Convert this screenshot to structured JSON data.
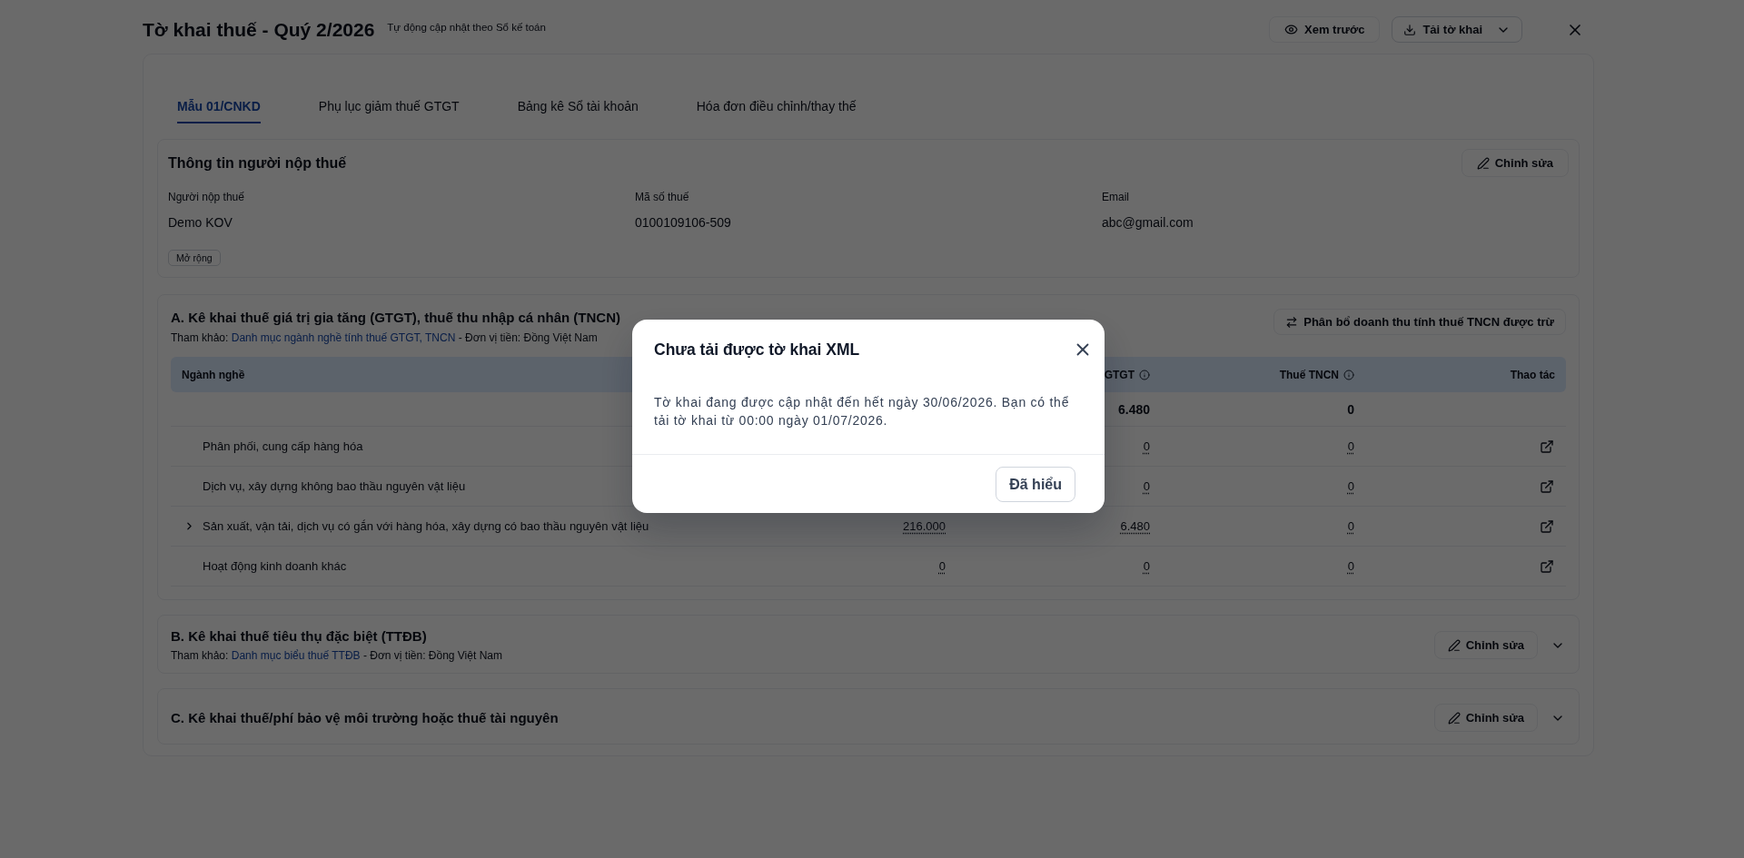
{
  "header": {
    "title": "Tờ khai thuế - Quý 2/2026",
    "subtitle": "Tự động cập nhật theo Sổ kế toán",
    "actions": [
      {
        "kind": "preview",
        "label": "Xem trước"
      },
      {
        "kind": "download",
        "label": "Tải tờ khai"
      }
    ]
  },
  "tabs": [
    {
      "label": "Mẫu 01/CNKD",
      "selected": true
    },
    {
      "label": "Phụ lục giảm thuế GTGT",
      "selected": false
    },
    {
      "label": "Bảng kê Sổ tài khoản",
      "selected": false
    },
    {
      "label": "Hóa đơn điều chỉnh/thay thế",
      "selected": false
    }
  ],
  "taxpayer": {
    "title": "Thông tin người nộp thuế",
    "edit_label": "Chỉnh sửa",
    "fields": [
      {
        "label": "Người nộp thuế",
        "value": "Demo KOV"
      },
      {
        "label": "Mã số thuế",
        "value": "0100109106-509"
      },
      {
        "label": "Email",
        "value": "abc@gmail.com"
      }
    ],
    "expand_label": "Mở rộng"
  },
  "sections": [
    {
      "kind": "table",
      "title": "A. Kê khai thuế giá trị gia tăng (GTGT), thuế thu nhập cá nhân (TNCN)",
      "reference": {
        "prefix": "Tham khảo:",
        "link": "Danh mục ngành nghề tính thuế GTGT, TNCN",
        "suffix": "- Đơn vị tiền: Đồng Việt Nam"
      },
      "action_label": "Phân bổ doanh thu tính thuế TNCN được trừ",
      "table": {
        "columns": [
          {
            "kind": "name",
            "label": "Ngành nghề"
          },
          {
            "kind": "revenue"
          },
          {
            "kind": "vat",
            "label": "GTGT",
            "info": true
          },
          {
            "kind": "pit",
            "label": "Thuế TNCN",
            "info": true
          },
          {
            "kind": "action",
            "label": "Thao tác"
          }
        ],
        "rows": [
          {
            "kind": "total",
            "vat": "6.480",
            "pit": "0"
          },
          {
            "kind": "item",
            "name": "Phân phối, cung cấp hàng hóa",
            "vat": "0",
            "pit": "0",
            "expandable": false
          },
          {
            "kind": "item",
            "name": "Dịch vụ, xây dựng không bao thầu nguyên vật liệu",
            "vat": "0",
            "pit": "0",
            "expandable": false
          },
          {
            "kind": "item",
            "name": "Sản xuất, vận tải, dịch vụ có gắn với hàng hóa, xây dựng có bao thầu nguyên vật liệu",
            "revenue": "216.000",
            "vat": "6.480",
            "pit": "0",
            "expandable": true,
            "expanded": false
          },
          {
            "kind": "item",
            "name": "Hoạt động kinh doanh khác",
            "revenue": "0",
            "vat": "0",
            "pit": "0",
            "expandable": false
          }
        ]
      }
    },
    {
      "kind": "collapsible",
      "title": "B. Kê khai thuế tiêu thụ đặc biệt (TTĐB)",
      "reference": {
        "prefix": "Tham khảo:",
        "link": "Danh mục biểu thuế TTĐB",
        "suffix": "- Đơn vị tiền: Đồng Việt Nam"
      },
      "edit_label": "Chỉnh sửa",
      "expanded": false
    },
    {
      "kind": "collapsible",
      "title": "C. Kê khai thuế/phí bảo vệ môi trường hoặc thuế tài nguyên",
      "edit_label": "Chỉnh sửa",
      "expanded": false
    }
  ],
  "dialog": {
    "title": "Chưa tải được tờ khai XML",
    "message": "Tờ khai đang được cập nhật đến hết ngày 30/06/2026. Bạn có thể tải tờ khai từ 00:00 ngày 01/07/2026.",
    "confirm_label": "Đã hiểu"
  }
}
